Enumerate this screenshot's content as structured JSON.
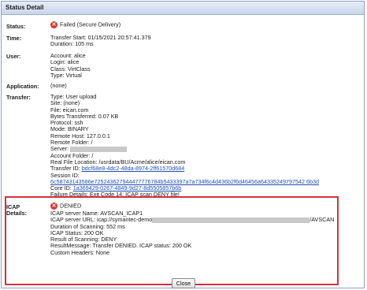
{
  "window": {
    "title": "Status Detail"
  },
  "labels": {
    "status": "Status:",
    "time": "Time:",
    "user": "User:",
    "application": "Application:",
    "transfer": "Transfer:",
    "icap_line1": "ICAP",
    "icap_line2": "Details:"
  },
  "status": {
    "text": "Failed (Secure Delivery)"
  },
  "time": {
    "start": "Transfer Start: 01/15/2021 20:57:41.379",
    "duration": "Duration: 105 ms"
  },
  "user": {
    "account": "Account: alice",
    "login": "Login: alice",
    "class": "Class: VirtClass",
    "type": "Type: Virtual"
  },
  "application": {
    "value": "(none)"
  },
  "transfer": {
    "type": "Type: User upload",
    "site": "Site: (none)",
    "file": "File: eican.com",
    "bytes": "Bytes Transferred: 0.07 KB",
    "protocol": "Protocol: ssh",
    "mode": "Mode: BINARY",
    "remote_host": "Remote Host: 127.0.0.1",
    "remote_folder": "Remote Folder: /",
    "server_label": "Server:",
    "account_folder": "Account Folder: /",
    "real_file": "Real File Location: /usrdata/BU/Acme/alice/eican.com",
    "transfer_id_label": "Transfer ID:",
    "transfer_id": "bdcf68e8-4dc2-48da-8974-2ff61570d684",
    "session_id_label": "Session ID:",
    "session_id": "6c58743143586e725243627944477776784b5433397a7a734f6c4d436b2f6d46456a64335249797542 6b3d",
    "core_id_label": "Core ID:",
    "core_id": "1a369429-0267-4849-9d27-8d5505857b6b",
    "failure": "Failure Details: Exit Code 14: ICAP scan DENY file!"
  },
  "icap": {
    "result": "DENIED",
    "server_name": "ICAP server Name: AVSCAN_ICAP1",
    "server_url_prefix": "ICAP server URL: icap://symantec-demo",
    "server_url_suffix": "/AVSCAN",
    "duration": "Duration of Scanning: 552 ms",
    "status": "ICAP Status: 200 OK",
    "result_scanning": "Result of Scanning: DENY",
    "result_message": "ResultMessage: Transfer DENIED. ICAP status: 200 OK",
    "custom_headers": "Custom Headers: None"
  },
  "buttons": {
    "close": "Close"
  },
  "colors": {
    "error": "#d9352b",
    "highlight_box": "#d6323a",
    "link": "#1f4fb8"
  }
}
